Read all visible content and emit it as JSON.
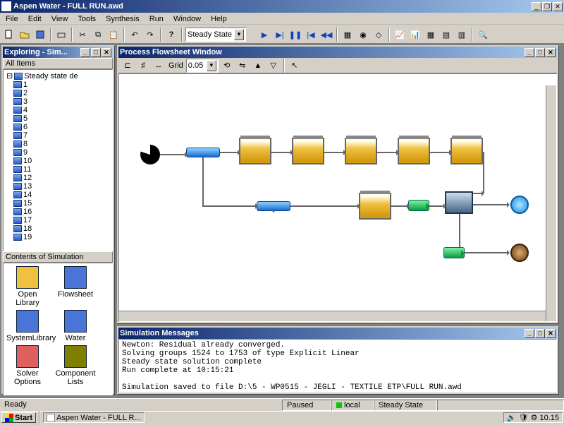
{
  "app": {
    "title": "Aspen Water - FULL RUN.awd"
  },
  "menu": [
    "File",
    "Edit",
    "View",
    "Tools",
    "Synthesis",
    "Run",
    "Window",
    "Help"
  ],
  "toolbar": {
    "mode_combo": "Steady State"
  },
  "explorer": {
    "window_title": "Exploring - Sim...",
    "all_items_label": "All Items",
    "root_label": "Steady state de",
    "tree_items": [
      "1",
      "2",
      "3",
      "4",
      "5",
      "6",
      "7",
      "8",
      "9",
      "10",
      "11",
      "12",
      "13",
      "14",
      "15",
      "16",
      "17",
      "18",
      "19"
    ],
    "contents_label": "Contents of Simulation",
    "icons": [
      {
        "label": "Open Library"
      },
      {
        "label": "Flowsheet"
      },
      {
        "label": "SystemLibrary"
      },
      {
        "label": "Water"
      },
      {
        "label": "Solver Options"
      },
      {
        "label": "Component Lists"
      }
    ]
  },
  "flowsheet": {
    "window_title": "Process Flowsheet Window",
    "grid_label": "Grid",
    "grid_value": "0.05"
  },
  "messages": {
    "window_title": "Simulation Messages",
    "lines": [
      "Newton: Residual already converged.",
      "Solving groups 1524 to 1753 of type Explicit Linear",
      "Steady state solution complete",
      "Run complete at 10:15:21",
      "",
      "Simulation saved to file D:\\5 - WP0515 - JEGLI - TEXTILE ETP\\FULL RUN.awd"
    ]
  },
  "status": {
    "left": "Ready",
    "runstate": "Paused",
    "scope": "local",
    "mode": "Steady State"
  },
  "taskbar": {
    "start": "Start",
    "task": "Aspen Water - FULL R...",
    "clock": "10.15"
  }
}
